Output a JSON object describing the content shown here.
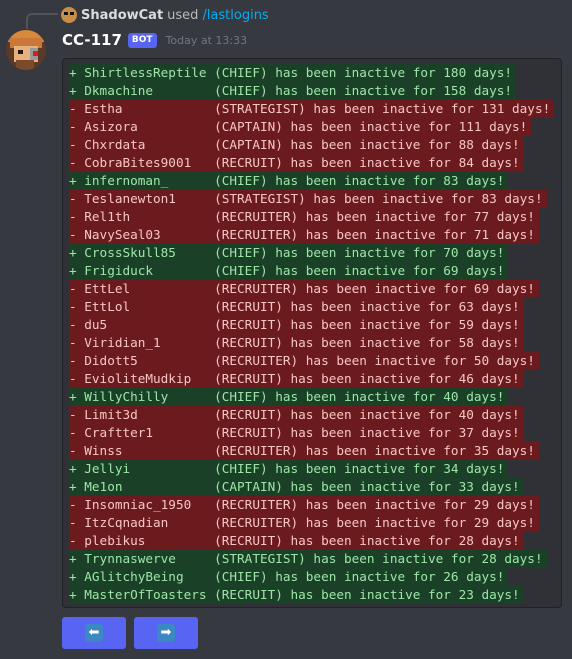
{
  "reply": {
    "username": "ShadowCat",
    "used_text": "used",
    "command": "/lastlogins"
  },
  "message": {
    "author": "CC-117",
    "badge": "BOT",
    "timestamp": "Today at 13:33"
  },
  "lines": [
    {
      "type": "add",
      "text": "+ ShirtlessReptile (CHIEF) has been inactive for 180 days!"
    },
    {
      "type": "add",
      "text": "+ Dkmachine        (CHIEF) has been inactive for 158 days!"
    },
    {
      "type": "rem",
      "text": "- Estha            (STRATEGIST) has been inactive for 131 days!"
    },
    {
      "type": "rem",
      "text": "- Asizora          (CAPTAIN) has been inactive for 111 days!"
    },
    {
      "type": "rem",
      "text": "- Chxrdata         (CAPTAIN) has been inactive for 88 days!"
    },
    {
      "type": "rem",
      "text": "- CobraBites9001   (RECRUIT) has been inactive for 84 days!"
    },
    {
      "type": "add",
      "text": "+ infernoman_      (CHIEF) has been inactive for 83 days!"
    },
    {
      "type": "rem",
      "text": "- Teslanewton1     (STRATEGIST) has been inactive for 83 days!"
    },
    {
      "type": "rem",
      "text": "- Rel1th           (RECRUITER) has been inactive for 77 days!"
    },
    {
      "type": "rem",
      "text": "- NavySeal03       (RECRUITER) has been inactive for 71 days!"
    },
    {
      "type": "add",
      "text": "+ CrossSkull85     (CHIEF) has been inactive for 70 days!"
    },
    {
      "type": "add",
      "text": "+ Frigiduck        (CHIEF) has been inactive for 69 days!"
    },
    {
      "type": "rem",
      "text": "- EttLel           (RECRUITER) has been inactive for 69 days!"
    },
    {
      "type": "rem",
      "text": "- EttLol           (RECRUIT) has been inactive for 63 days!"
    },
    {
      "type": "rem",
      "text": "- du5              (RECRUIT) has been inactive for 59 days!"
    },
    {
      "type": "rem",
      "text": "- Viridian_1       (RECRUIT) has been inactive for 58 days!"
    },
    {
      "type": "rem",
      "text": "- Didott5          (RECRUITER) has been inactive for 50 days!"
    },
    {
      "type": "rem",
      "text": "- EvioliteMudkip   (RECRUIT) has been inactive for 46 days!"
    },
    {
      "type": "add",
      "text": "+ WillyChilly      (CHIEF) has been inactive for 40 days!"
    },
    {
      "type": "rem",
      "text": "- Limit3d          (RECRUIT) has been inactive for 40 days!"
    },
    {
      "type": "rem",
      "text": "- Craftter1        (RECRUIT) has been inactive for 37 days!"
    },
    {
      "type": "rem",
      "text": "- Winss            (RECRUITER) has been inactive for 35 days!"
    },
    {
      "type": "add",
      "text": "+ Jellyi           (CHIEF) has been inactive for 34 days!"
    },
    {
      "type": "add",
      "text": "+ Me1on            (CAPTAIN) has been inactive for 33 days!"
    },
    {
      "type": "rem",
      "text": "- Insomniac_1950   (RECRUITER) has been inactive for 29 days!"
    },
    {
      "type": "rem",
      "text": "- ItzCqnadian      (RECRUITER) has been inactive for 29 days!"
    },
    {
      "type": "rem",
      "text": "- plebikus         (RECRUIT) has been inactive for 28 days!"
    },
    {
      "type": "add",
      "text": "+ Trynnaswerve     (STRATEGIST) has been inactive for 28 days!"
    },
    {
      "type": "add",
      "text": "+ AGlitchyBeing    (CHIEF) has been inactive for 26 days!"
    },
    {
      "type": "add",
      "text": "+ MasterOfToasters (RECRUIT) has been inactive for 23 days!"
    }
  ],
  "buttons": {
    "prev_icon": "left-arrow-icon",
    "next_icon": "right-arrow-icon",
    "prev_glyph": "⬅",
    "next_glyph": "➡"
  },
  "colors": {
    "background": "#36393f",
    "codeblock": "#2f3136",
    "add_bg": "#1a4127",
    "add_text": "#9ee5a8",
    "remove_bg": "#6b1a1d",
    "remove_text": "#f7c6c6",
    "button": "#5865f2",
    "command_link": "#00aff4"
  }
}
